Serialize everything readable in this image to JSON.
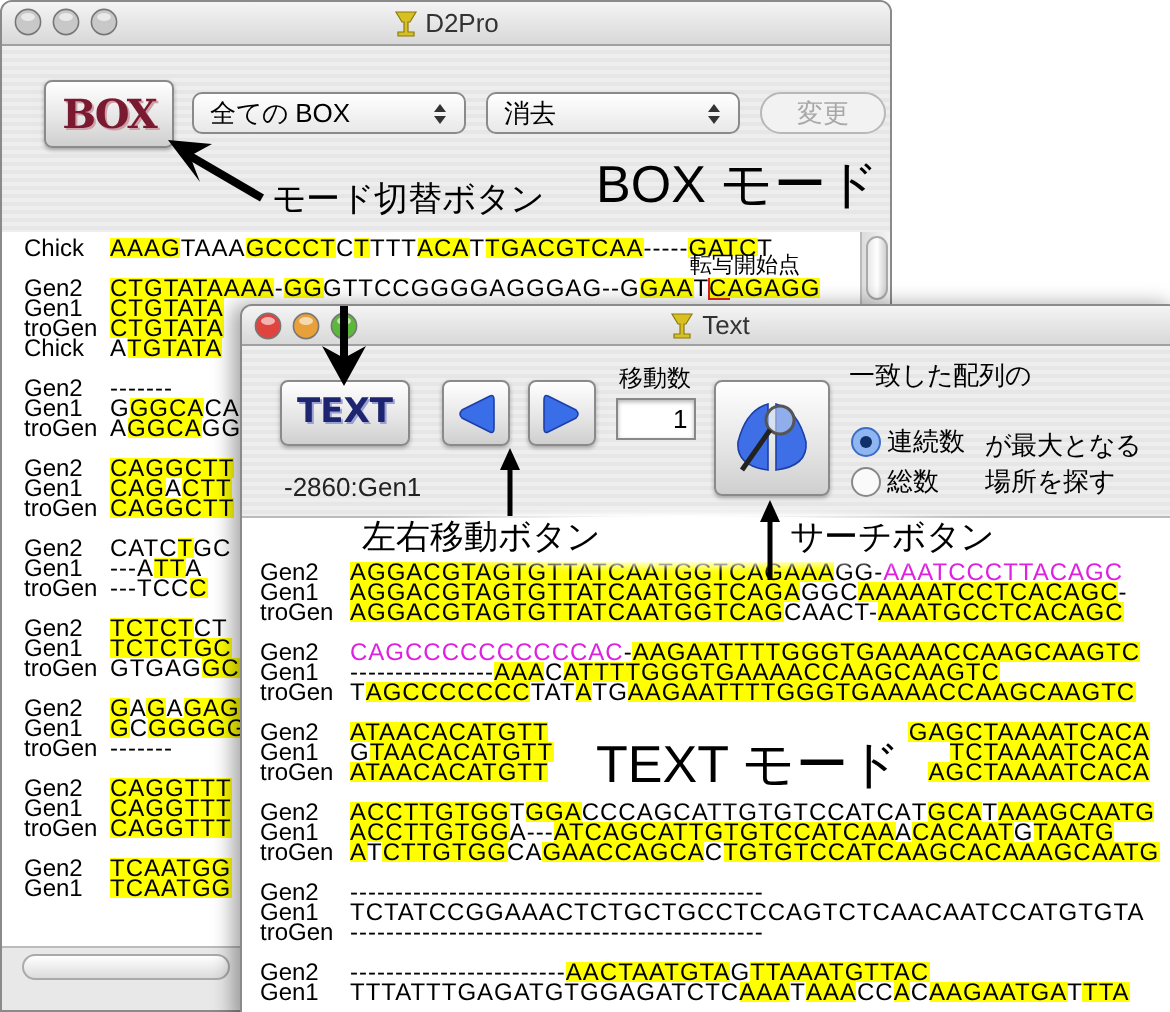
{
  "back_window": {
    "title": "D2Pro",
    "active": false,
    "mode_button": "BOX",
    "selects": [
      {
        "value": "全ての BOX"
      },
      {
        "value": "消去"
      }
    ],
    "change_button": {
      "label": "変更",
      "disabled": true
    },
    "blocks": [
      {
        "rows": [
          {
            "label": "Chick",
            "segments": [
              {
                "kind": "match",
                "text": "AAAG"
              },
              {
                "kind": "plain",
                "text": "TAAA"
              },
              {
                "kind": "match",
                "text": "GCCCT"
              },
              {
                "kind": "plain",
                "text": "C"
              },
              {
                "kind": "match",
                "text": "T"
              },
              {
                "kind": "plain",
                "text": "TTT"
              },
              {
                "kind": "match",
                "text": "ACA"
              },
              {
                "kind": "plain",
                "text": "T"
              },
              {
                "kind": "match",
                "text": "TGACGTCAA"
              },
              {
                "kind": "plain",
                "text": "-----"
              },
              {
                "kind": "match",
                "text": "GATC"
              },
              {
                "kind": "plain",
                "text": "T"
              }
            ]
          }
        ]
      },
      {
        "rows": [
          {
            "label": "Gen2",
            "segments": [
              {
                "kind": "match",
                "text": "CTGTATAAAA"
              },
              {
                "kind": "plain",
                "text": "-"
              },
              {
                "kind": "match",
                "text": "GG"
              },
              {
                "kind": "plain",
                "text": "GTTCCGGGGAGGGAG--G"
              },
              {
                "kind": "match",
                "text": "GAA"
              },
              {
                "kind": "plain",
                "text": "T"
              },
              {
                "kind": "start",
                "text": "C"
              },
              {
                "kind": "match",
                "text": "AGAGG"
              }
            ]
          },
          {
            "label": "Gen1",
            "segments": [
              {
                "kind": "match",
                "text": "CTGTATA"
              }
            ]
          },
          {
            "label": "troGen",
            "segments": [
              {
                "kind": "match",
                "text": "CTGTATA"
              }
            ]
          },
          {
            "label": "Chick",
            "segments": [
              {
                "kind": "plain",
                "text": "A"
              },
              {
                "kind": "match",
                "text": "TGTATA"
              }
            ]
          }
        ]
      },
      {
        "rows": [
          {
            "label": "Gen2",
            "segments": [
              {
                "kind": "plain",
                "text": "-------"
              }
            ]
          },
          {
            "label": "Gen1",
            "segments": [
              {
                "kind": "plain",
                "text": "G"
              },
              {
                "kind": "match",
                "text": "GGCA"
              },
              {
                "kind": "plain",
                "text": "CA"
              }
            ]
          },
          {
            "label": "troGen",
            "segments": [
              {
                "kind": "plain",
                "text": "A"
              },
              {
                "kind": "match",
                "text": "GGCA"
              },
              {
                "kind": "plain",
                "text": "GG"
              }
            ]
          }
        ]
      },
      {
        "rows": [
          {
            "label": "Gen2",
            "segments": [
              {
                "kind": "match",
                "text": "CAGGCTT"
              }
            ]
          },
          {
            "label": "Gen1",
            "segments": [
              {
                "kind": "match",
                "text": "CAG"
              },
              {
                "kind": "plain",
                "text": "A"
              },
              {
                "kind": "match",
                "text": "CTT"
              }
            ]
          },
          {
            "label": "troGen",
            "segments": [
              {
                "kind": "match",
                "text": "CAGGCTT"
              }
            ]
          }
        ]
      },
      {
        "rows": [
          {
            "label": "Gen2",
            "segments": [
              {
                "kind": "plain",
                "text": "CATC"
              },
              {
                "kind": "match",
                "text": "T"
              },
              {
                "kind": "plain",
                "text": "GC"
              }
            ]
          },
          {
            "label": "Gen1",
            "segments": [
              {
                "kind": "plain",
                "text": "---A"
              },
              {
                "kind": "match",
                "text": "TT"
              },
              {
                "kind": "plain",
                "text": "A"
              }
            ]
          },
          {
            "label": "troGen",
            "segments": [
              {
                "kind": "plain",
                "text": "---TCC"
              },
              {
                "kind": "match",
                "text": "C"
              }
            ]
          }
        ]
      },
      {
        "rows": [
          {
            "label": "Gen2",
            "segments": [
              {
                "kind": "match",
                "text": "TCTCT"
              },
              {
                "kind": "plain",
                "text": "CT"
              }
            ]
          },
          {
            "label": "Gen1",
            "segments": [
              {
                "kind": "match",
                "text": "TCTCTGC"
              }
            ]
          },
          {
            "label": "troGen",
            "segments": [
              {
                "kind": "plain",
                "text": "GTGAG"
              },
              {
                "kind": "match",
                "text": "GC"
              }
            ]
          }
        ]
      },
      {
        "rows": [
          {
            "label": "Gen2",
            "segments": [
              {
                "kind": "match",
                "text": "G"
              },
              {
                "kind": "plain",
                "text": "A"
              },
              {
                "kind": "match",
                "text": "G"
              },
              {
                "kind": "plain",
                "text": "A"
              },
              {
                "kind": "match",
                "text": "GAG"
              }
            ]
          },
          {
            "label": "Gen1",
            "segments": [
              {
                "kind": "match",
                "text": "G"
              },
              {
                "kind": "plain",
                "text": "C"
              },
              {
                "kind": "match",
                "text": "GGGGG"
              }
            ]
          },
          {
            "label": "troGen",
            "segments": [
              {
                "kind": "plain",
                "text": "-------"
              }
            ]
          }
        ]
      },
      {
        "rows": [
          {
            "label": "Gen2",
            "segments": [
              {
                "kind": "match",
                "text": "CAGGTTT"
              }
            ]
          },
          {
            "label": "Gen1",
            "segments": [
              {
                "kind": "match",
                "text": "CAGGTTT"
              }
            ]
          },
          {
            "label": "troGen",
            "segments": [
              {
                "kind": "match",
                "text": "CAGGTTT"
              }
            ]
          }
        ]
      },
      {
        "rows": [
          {
            "label": "Gen2",
            "segments": [
              {
                "kind": "match",
                "text": "TCAATGG"
              }
            ]
          },
          {
            "label": "Gen1",
            "segments": [
              {
                "kind": "match",
                "text": "TCAATGG"
              }
            ]
          }
        ]
      }
    ]
  },
  "front_window": {
    "title": "Text",
    "active": true,
    "mode_button": "TEXT",
    "position": "-2860:Gen1",
    "step_label": "移動数",
    "step_value": "1",
    "search_caption": "一致した配列の",
    "options": [
      {
        "label": "連続数",
        "selected": true
      },
      {
        "label": "総数",
        "selected": false
      }
    ],
    "option_suffix": [
      "が最大となる",
      "場所を探す"
    ],
    "blocks": [
      {
        "rows": [
          {
            "label": "Gen2",
            "segments": [
              {
                "kind": "match",
                "text": "AGGACGTAGTGTTATCAATGGTCAGAAA"
              },
              {
                "kind": "plain",
                "text": "GG-"
              },
              {
                "kind": "insert",
                "text": "AAATCCCTTACAGC"
              }
            ]
          },
          {
            "label": "Gen1",
            "segments": [
              {
                "kind": "match",
                "text": "AGGACGTAGTGTTATCAATGGTCAGA"
              },
              {
                "kind": "plain",
                "text": "GGC"
              },
              {
                "kind": "match",
                "text": "AAAAATCCTCACAGC"
              },
              {
                "kind": "plain",
                "text": "-"
              }
            ]
          },
          {
            "label": "troGen",
            "segments": [
              {
                "kind": "match",
                "text": "AGGACGTAGTGTTATCAATGGTCAG"
              },
              {
                "kind": "plain",
                "text": "CAACT-"
              },
              {
                "kind": "match",
                "text": "AAATGCCTCACAGC"
              }
            ]
          }
        ]
      },
      {
        "rows": [
          {
            "label": "Gen2",
            "segments": [
              {
                "kind": "insert",
                "text": "CAGCCCCCCCCCCAC"
              },
              {
                "kind": "plain",
                "text": "-"
              },
              {
                "kind": "match",
                "text": "AAGAATTTTGGGTGAAAACCAAGCAAGTC"
              }
            ]
          },
          {
            "label": "Gen1",
            "segments": [
              {
                "kind": "plain",
                "text": "----------------"
              },
              {
                "kind": "match",
                "text": "AAA"
              },
              {
                "kind": "plain",
                "text": "C"
              },
              {
                "kind": "match",
                "text": "ATTTTGGGTGAAAACCAAGCAAGTC"
              }
            ]
          },
          {
            "label": "troGen",
            "segments": [
              {
                "kind": "plain",
                "text": "T"
              },
              {
                "kind": "match",
                "text": "AGCCCCCCC"
              },
              {
                "kind": "plain",
                "text": "TAT"
              },
              {
                "kind": "match",
                "text": "A"
              },
              {
                "kind": "plain",
                "text": "TG"
              },
              {
                "kind": "match",
                "text": "AAGAATTTTGGGTGAAAACCAAGCAAGTC"
              }
            ]
          }
        ]
      },
      {
        "rows": [
          {
            "label": "Gen2",
            "segments": [
              {
                "kind": "match",
                "text": "ATAACACATGTT"
              }
            ],
            "tail_segments": [
              {
                "kind": "match",
                "text": "GAGCTAAAATCACA"
              }
            ]
          },
          {
            "label": "Gen1",
            "segments": [
              {
                "kind": "plain",
                "text": "G"
              },
              {
                "kind": "match",
                "text": "TAACACATGTT"
              }
            ],
            "tail_segments": [
              {
                "kind": "match",
                "text": "TCTAAAATCACA"
              }
            ]
          },
          {
            "label": "troGen",
            "segments": [
              {
                "kind": "match",
                "text": "ATAACACATGTT"
              }
            ],
            "tail_segments": [
              {
                "kind": "match",
                "text": "AGCTAAAATCACA"
              }
            ]
          }
        ]
      },
      {
        "rows": [
          {
            "label": "Gen2",
            "segments": [
              {
                "kind": "match",
                "text": "ACCTTGTGG"
              },
              {
                "kind": "plain",
                "text": "T"
              },
              {
                "kind": "match",
                "text": "GGA"
              },
              {
                "kind": "plain",
                "text": "CCCAGCATTGTGTCCATCA"
              },
              {
                "kind": "plain",
                "text": "T"
              },
              {
                "kind": "match",
                "text": "GCA"
              },
              {
                "kind": "plain",
                "text": "T"
              },
              {
                "kind": "match",
                "text": "AAAGCAATG"
              }
            ]
          },
          {
            "label": "Gen1",
            "segments": [
              {
                "kind": "match",
                "text": "ACCTTGTGG"
              },
              {
                "kind": "plain",
                "text": "A---"
              },
              {
                "kind": "match",
                "text": "ATCAGCATTGTGTCCATCAA"
              },
              {
                "kind": "plain",
                "text": "A"
              },
              {
                "kind": "match",
                "text": "CACAAT"
              },
              {
                "kind": "plain",
                "text": "G"
              },
              {
                "kind": "match",
                "text": "TAATG"
              }
            ]
          },
          {
            "label": "troGen",
            "segments": [
              {
                "kind": "match",
                "text": "A"
              },
              {
                "kind": "plain",
                "text": "T"
              },
              {
                "kind": "match",
                "text": "CTTGTGG"
              },
              {
                "kind": "plain",
                "text": "CA"
              },
              {
                "kind": "match",
                "text": "GAACCAGCA"
              },
              {
                "kind": "plain",
                "text": "C"
              },
              {
                "kind": "match",
                "text": "TGTGTCCATCAAGCACAAAGCAATG"
              }
            ]
          }
        ]
      },
      {
        "rows": [
          {
            "label": "Gen2",
            "segments": [
              {
                "kind": "plain",
                "text": "----------------------------------------------"
              }
            ]
          },
          {
            "label": "Gen1",
            "segments": [
              {
                "kind": "plain",
                "text": "TCTATCCGGAAACTCTGCTGCCTCCAGTCTCAACAATCCATGTGTA"
              }
            ]
          },
          {
            "label": "troGen",
            "segments": [
              {
                "kind": "plain",
                "text": "----------------------------------------------"
              }
            ]
          }
        ]
      },
      {
        "rows": [
          {
            "label": "Gen2",
            "segments": [
              {
                "kind": "plain",
                "text": "------------------------"
              },
              {
                "kind": "match",
                "text": "AACTAATGTA"
              },
              {
                "kind": "plain",
                "text": "G"
              },
              {
                "kind": "match",
                "text": "TTAAATGTTAC"
              }
            ]
          },
          {
            "label": "Gen1",
            "segments": [
              {
                "kind": "plain",
                "text": "TTTATTTGAGATGTGGAGATCTC"
              },
              {
                "kind": "match",
                "text": "AAA"
              },
              {
                "kind": "plain",
                "text": "T"
              },
              {
                "kind": "match",
                "text": "AAA"
              },
              {
                "kind": "plain",
                "text": "CC"
              },
              {
                "kind": "match",
                "text": "A"
              },
              {
                "kind": "plain",
                "text": "C"
              },
              {
                "kind": "match",
                "text": "AAGAATGA"
              },
              {
                "kind": "plain",
                "text": "T"
              },
              {
                "kind": "match",
                "text": "TTA"
              }
            ]
          }
        ]
      }
    ]
  },
  "annotations": [
    {
      "kind": "callout",
      "text": "モード切替ボタン"
    },
    {
      "kind": "heading",
      "text": "BOX モード"
    },
    {
      "kind": "note",
      "text": "転写開始点"
    },
    {
      "kind": "callout",
      "text": "左右移動ボタン"
    },
    {
      "kind": "callout",
      "text": "サーチボタン"
    },
    {
      "kind": "heading",
      "text": "TEXT モード"
    }
  ]
}
